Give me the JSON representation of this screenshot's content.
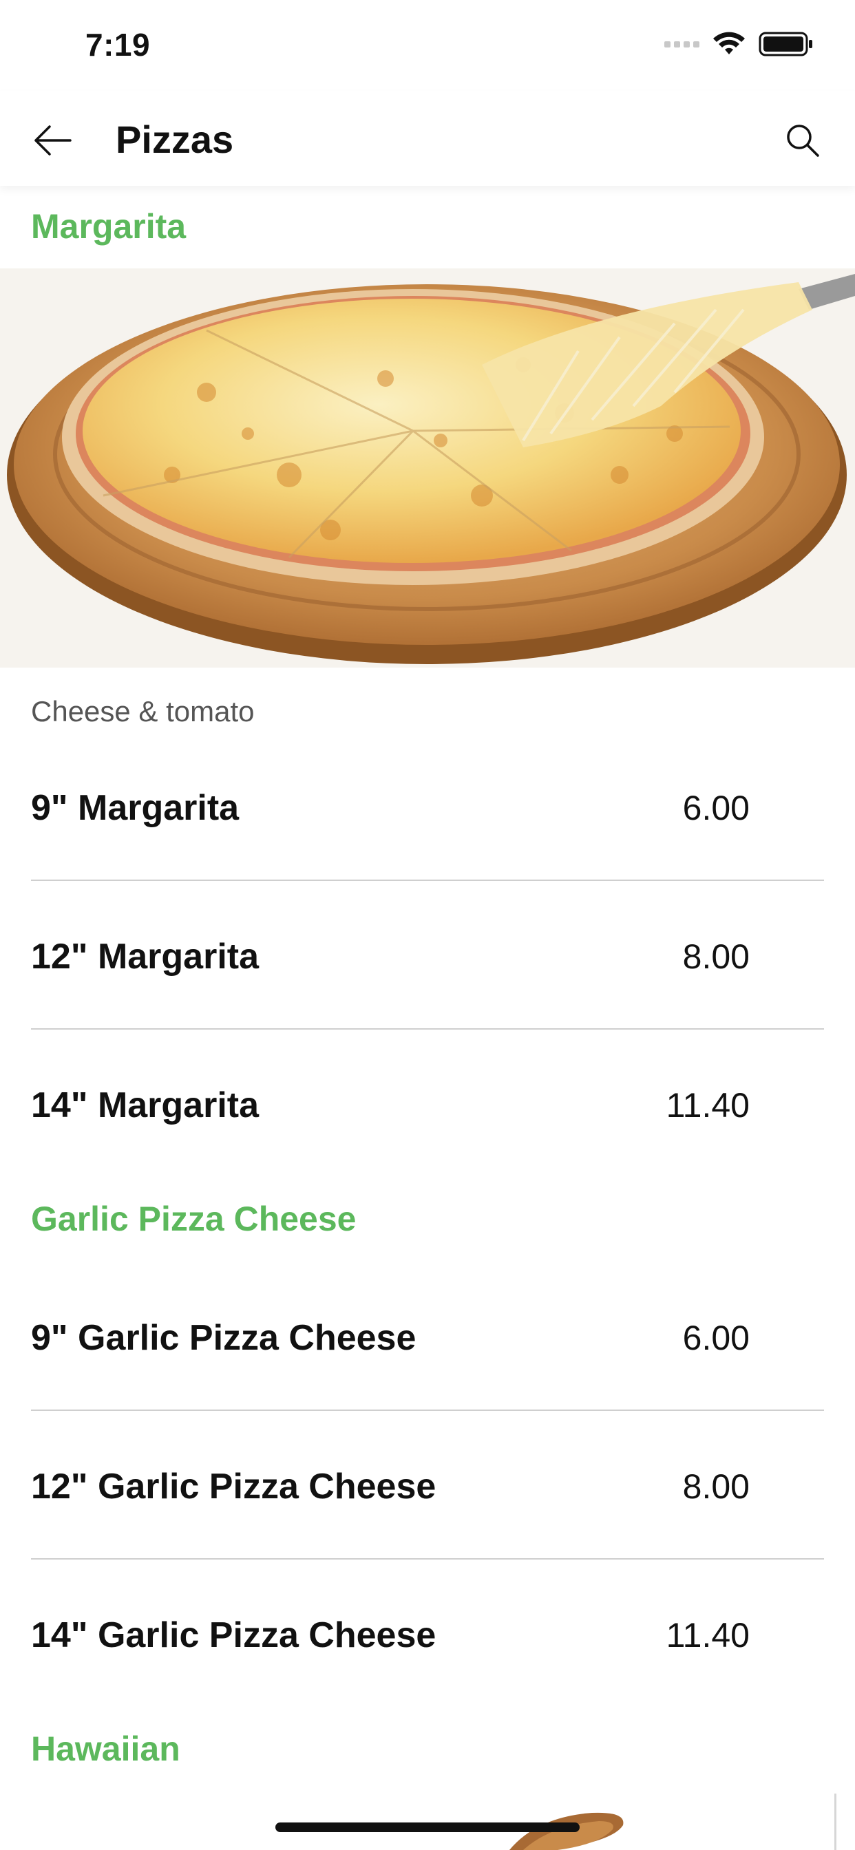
{
  "status": {
    "time": "7:19"
  },
  "nav": {
    "title": "Pizzas"
  },
  "sections": [
    {
      "title": "Margarita",
      "description": "Cheese & tomato",
      "items": [
        {
          "name": "9\" Margarita",
          "price": "6.00"
        },
        {
          "name": "12\" Margarita",
          "price": "8.00"
        },
        {
          "name": "14\" Margarita",
          "price": "11.40"
        }
      ]
    },
    {
      "title": "Garlic Pizza Cheese",
      "items": [
        {
          "name": "9\" Garlic Pizza Cheese",
          "price": "6.00"
        },
        {
          "name": "12\" Garlic Pizza Cheese",
          "price": "8.00"
        },
        {
          "name": "14\" Garlic Pizza Cheese",
          "price": "11.40"
        }
      ]
    },
    {
      "title": "Hawaiian"
    }
  ],
  "colors": {
    "accent": "#5cb85c",
    "divider": "#cfcfcf",
    "text": "#111111"
  },
  "icons": {
    "back": "arrow-left-icon",
    "search": "search-icon",
    "wifi": "wifi-icon",
    "battery": "battery-icon"
  }
}
